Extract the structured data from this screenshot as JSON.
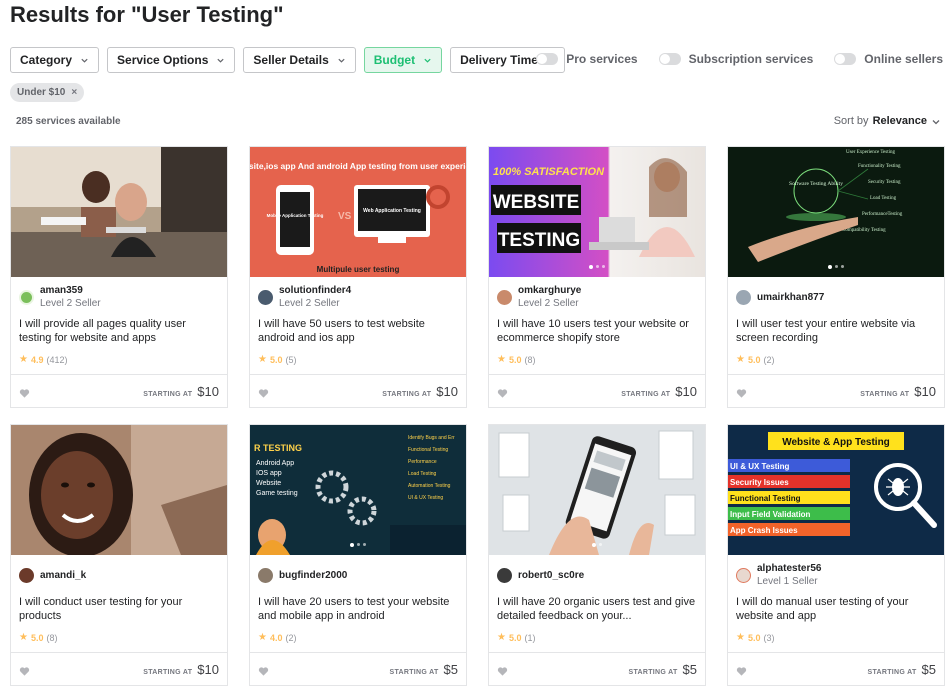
{
  "page": {
    "title": "Results for \"User Testing\""
  },
  "filters": [
    {
      "label": "Category",
      "active": false
    },
    {
      "label": "Service Options",
      "active": false
    },
    {
      "label": "Seller Details",
      "active": false
    },
    {
      "label": "Budget",
      "active": true
    },
    {
      "label": "Delivery Time",
      "active": false
    }
  ],
  "toggles": [
    {
      "label": "Pro services"
    },
    {
      "label": "Subscription services"
    },
    {
      "label": "Online sellers"
    }
  ],
  "active_chip": {
    "label": "Under $10",
    "remove_glyph": "×"
  },
  "results": {
    "count_text": "285 services available"
  },
  "sort": {
    "prefix": "Sort by",
    "value": "Relevance"
  },
  "price_label": "STARTING AT",
  "gigs": [
    {
      "seller": "aman359",
      "level": "Level 2 Seller",
      "title": "I will provide all pages quality user testing for website and apps",
      "score": "4.9",
      "count": "(412)",
      "price": "$10",
      "avatar_color": "#7bbf5b"
    },
    {
      "seller": "solutionfinder4",
      "level": "Level 2 Seller",
      "title": "I will have 50 users to test website android and ios app",
      "score": "5.0",
      "count": "(5)",
      "price": "$10",
      "avatar_color": "#4a5b6e"
    },
    {
      "seller": "omkarghurye",
      "level": "Level 2 Seller",
      "title": "I will have 10 users test your website or ecommerce shopify store",
      "score": "5.0",
      "count": "(8)",
      "price": "$10",
      "avatar_color": "#c98a6b"
    },
    {
      "seller": "umairkhan877",
      "level": "",
      "title": "I will user test your entire website via screen recording",
      "score": "5.0",
      "count": "(2)",
      "price": "$10",
      "avatar_color": "#9aa6b2"
    },
    {
      "seller": "amandi_k",
      "level": "",
      "title": "I will conduct user testing for your products",
      "score": "5.0",
      "count": "(8)",
      "price": "$10",
      "avatar_color": "#6b3a2a"
    },
    {
      "seller": "bugfinder2000",
      "level": "",
      "title": "I will have 20 users to test your website and mobile app in android",
      "score": "4.0",
      "count": "(2)",
      "price": "$5",
      "avatar_color": "#8a7a6a"
    },
    {
      "seller": "robert0_sc0re",
      "level": "",
      "title": "I will have 20 organic users test and give detailed feedback on your...",
      "score": "5.0",
      "count": "(1)",
      "price": "$5",
      "avatar_color": "#3a3a3a"
    },
    {
      "seller": "alphatester56",
      "level": "Level 1 Seller",
      "title": "I will do manual user testing of your website and app",
      "score": "5.0",
      "count": "(3)",
      "price": "$5",
      "avatar_color": "#e8d8cf"
    }
  ],
  "thumb_text": {
    "g2_title": "Website,ios app And android App testing from user experience",
    "g2_left": "Mobile Application Testing",
    "g2_vs": "VS",
    "g2_right": "Web Application Testing",
    "g2_bottom": "Multipule user testing",
    "g3_tag": "100% SATISFACTION",
    "g3_l1": "WEBSITE",
    "g3_l2": "TESTING",
    "g4_center": "Software Testing Ability",
    "g4_items": [
      "User Experience Testing",
      "Functionality Testing",
      "Security Testing",
      "Load Testing",
      "PerformanceTesting",
      "Compatibility Testing"
    ],
    "g6_head": "R TESTING",
    "g6_list": [
      "Android App",
      "IOS app",
      "Website",
      "Game testing"
    ],
    "g6_right": [
      "Identify Bugs and Err",
      "Functional Testing",
      "Performance",
      "Load Testing",
      "Automation Testing",
      "UI & UX Testing"
    ],
    "g8_head": "Website & App Testing",
    "g8_items": [
      "UI & UX Testing",
      "Security Issues",
      "Functional Testing",
      "Input Field Validation",
      "App Crash Issues"
    ]
  }
}
